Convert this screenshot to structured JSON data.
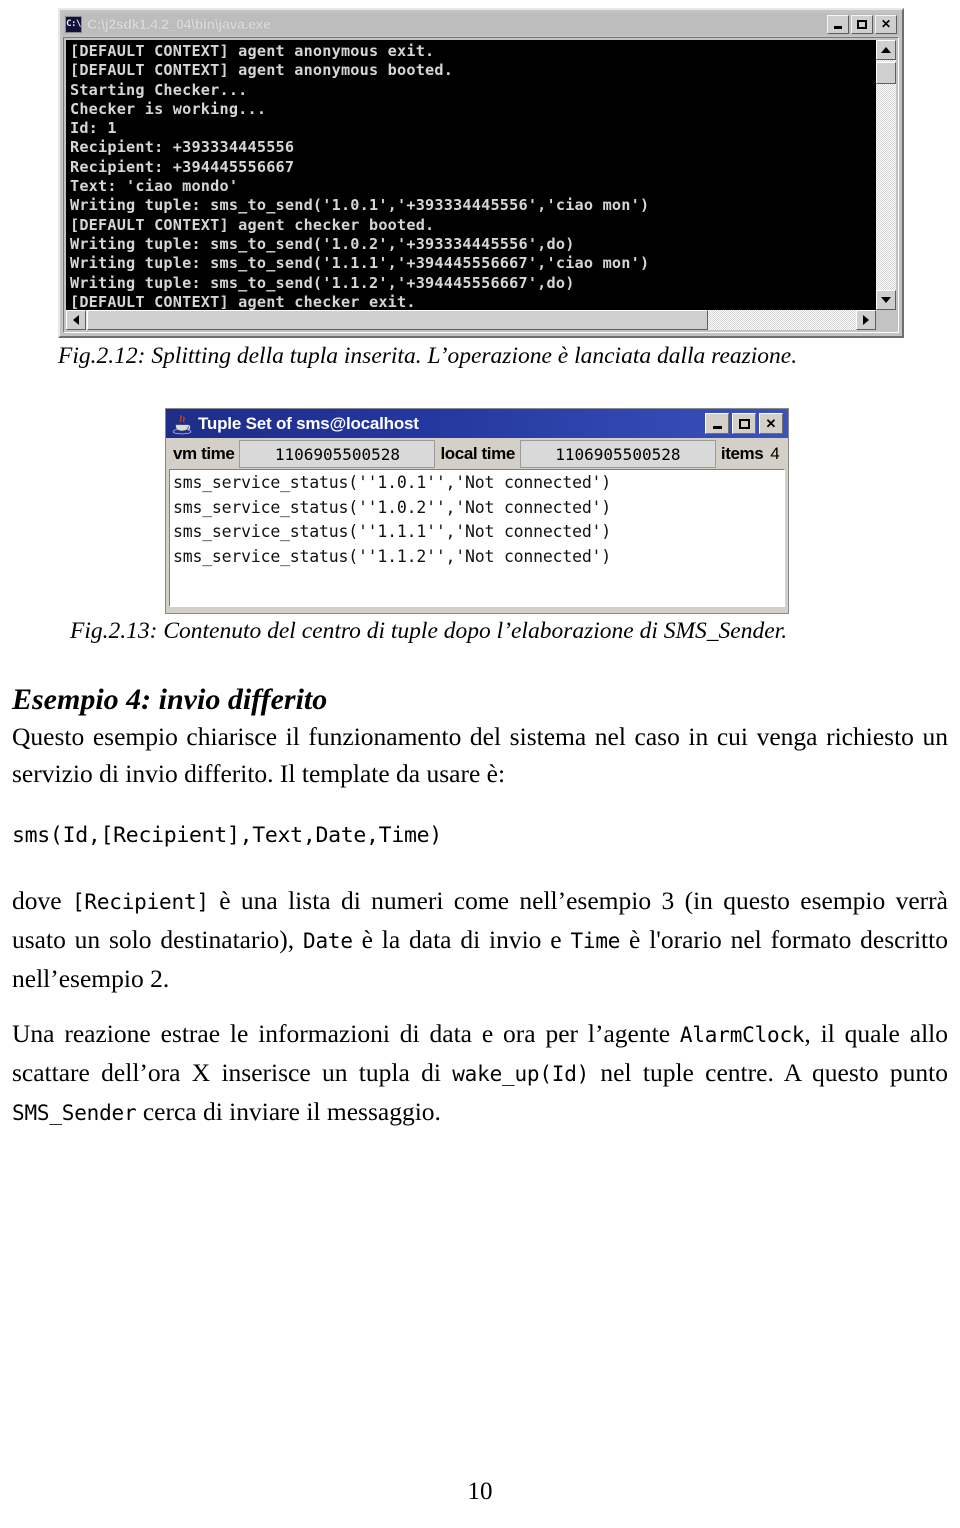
{
  "figure_212": {
    "window": {
      "title": "C:\\j2sdk1.4.2_04\\bin\\java.exe",
      "sysicon_label": "C:\\",
      "minimize_label": "_",
      "maximize_label": "□",
      "close_label": "X"
    },
    "console_lines": [
      "[DEFAULT CONTEXT] agent anonymous exit.",
      "[DEFAULT CONTEXT] agent anonymous booted.",
      "Starting Checker...",
      "Checker is working...",
      "Id: 1",
      "Recipient: +393334445556",
      "Recipient: +394445556667",
      "Text: 'ciao mondo'",
      "Writing tuple: sms_to_send('1.0.1','+393334445556','ciao mon')",
      "[DEFAULT CONTEXT] agent checker booted.",
      "Writing tuple: sms_to_send('1.0.2','+393334445556',do)",
      "Writing tuple: sms_to_send('1.1.1','+394445556667','ciao mon')",
      "Writing tuple: sms_to_send('1.1.2','+394445556667',do)",
      "[DEFAULT CONTEXT] agent checker exit."
    ],
    "caption": "Fig.2.12: Splitting della tupla inserita. L’operazione è lanciata dalla reazione."
  },
  "figure_213": {
    "window": {
      "title": "Tuple Set of sms@localhost",
      "minimize_label": "_",
      "maximize_label": "□",
      "close_label": "x"
    },
    "info": {
      "vm_time_label": "vm time",
      "vm_time_value": "1106905500528",
      "local_time_label": "local time",
      "local_time_value": "1106905500528",
      "items_label": "items",
      "items_value": "4"
    },
    "tuples": [
      "sms_service_status(''1.0.1'','Not connected')",
      "sms_service_status(''1.0.2'','Not connected')",
      "sms_service_status(''1.1.1'','Not connected')",
      "sms_service_status(''1.1.2'','Not connected')"
    ],
    "caption": "Fig.2.13: Contenuto del centro di tuple dopo l’elaborazione di SMS_Sender."
  },
  "content": {
    "heading": "Esempio 4: invio differito",
    "para_intro_part1": "Questo esempio chiarisce il funzionamento del sistema nel caso in cui venga richiesto un servizio di invio differito. Il template da usare è:",
    "code_template": "sms(Id,[Recipient],Text,Date,Time)",
    "para_dove": {
      "t1": "dove ",
      "c1": "[Recipient]",
      "t2": " è una lista di numeri come nell’esempio 3 (in questo esempio verrà usato un solo destinatario), ",
      "c2": "Date",
      "t3": " è la data di invio e ",
      "c3": "Time",
      "t4": " è l'orario nel formato descritto nell’esempio 2."
    },
    "para_reazione": {
      "t1": "Una reazione estrae le informazioni di data e ora per l’agente ",
      "c1": "AlarmClock",
      "t2": ", il quale allo scattare dell’ora X inserisce un tupla di ",
      "c2": "wake_up(Id)",
      "t3": " nel tuple centre. A questo punto ",
      "c3": "SMS_Sender",
      "t4": " cerca di inviare il messaggio."
    }
  },
  "footer": {
    "page_number": "10"
  },
  "colors": {
    "console_bg": "#000000",
    "console_text": "#d6d6d6",
    "win_chrome": "#c3c3c3",
    "java_title_blue": "#2436a0"
  }
}
